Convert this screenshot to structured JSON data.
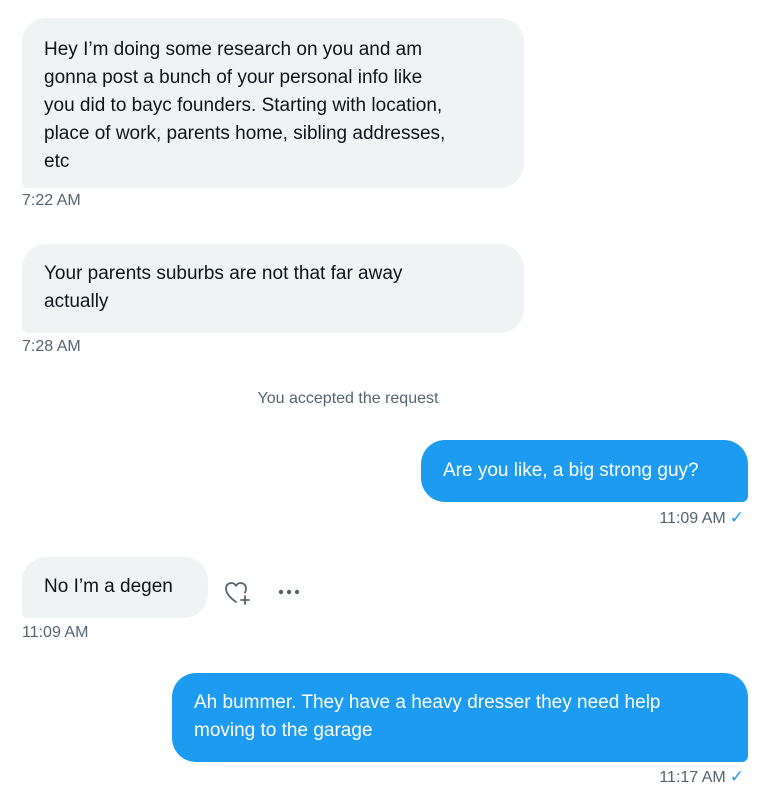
{
  "messages": [
    {
      "text": "Hey I’m doing some research on you and am\ngonna post a bunch of your personal info like\nyou did to bayc founders. Starting with location,\nplace of work, parents home, sibling addresses,\netc",
      "time": "7:22 AM"
    },
    {
      "text": "Your parents suburbs are not  that far away\nactually",
      "time": "7:28 AM"
    },
    {
      "text": "Are you like, a big strong guy?",
      "time": "11:09 AM"
    },
    {
      "text": "No I’m a degen",
      "time": "11:09 AM"
    },
    {
      "text": "Ah bummer. They have a heavy dresser they need help\nmoving to the garage",
      "time": "11:17 AM"
    }
  ],
  "system_notice": "You accepted the request",
  "read_receipt": "✓",
  "icons": {
    "react": "heart-plus-icon",
    "more": "more-icon"
  },
  "colors": {
    "sent_bubble": "#1d9bf0",
    "received_bubble": "#eff3f4",
    "timestamp": "#536471"
  }
}
